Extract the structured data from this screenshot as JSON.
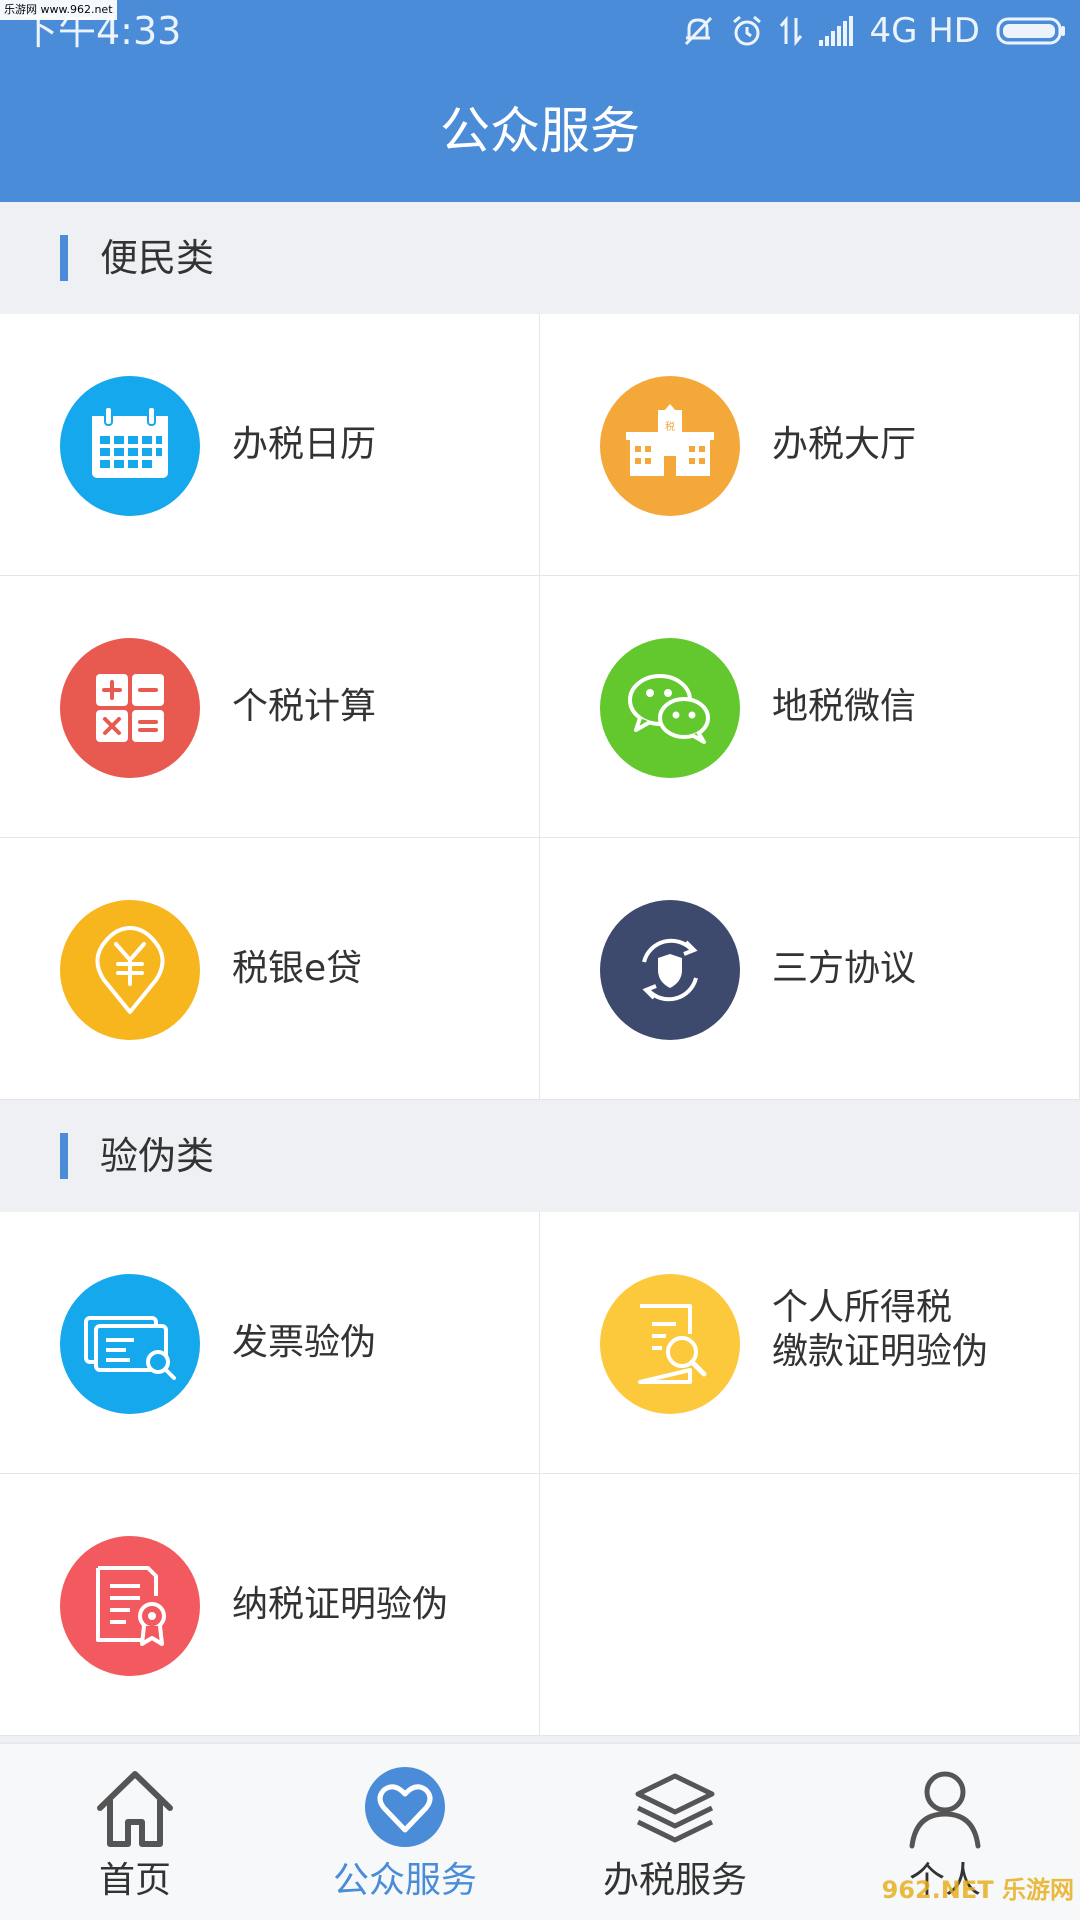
{
  "status_bar": {
    "watermark": "乐游网 www.962.net",
    "time": "下午4:33",
    "network": "4G HD"
  },
  "header": {
    "title": "公众服务"
  },
  "sections": [
    {
      "title": "便民类",
      "items": [
        {
          "label": "办税日历",
          "icon": "calendar-icon",
          "color": "#16a8ec"
        },
        {
          "label": "办税大厅",
          "icon": "tax-hall-building-icon",
          "color": "#f4a83a"
        },
        {
          "label": "个税计算",
          "icon": "calculator-icon",
          "color": "#e85a4f"
        },
        {
          "label": "地税微信",
          "icon": "wechat-icon",
          "color": "#62c82d"
        },
        {
          "label": "税银e贷",
          "icon": "yen-loan-icon",
          "color": "#f7b51e"
        },
        {
          "label": "三方协议",
          "icon": "shield-sync-icon",
          "color": "#3d4a6e"
        }
      ]
    },
    {
      "title": "验伪类",
      "items": [
        {
          "label": "发票验伪",
          "icon": "invoice-search-icon",
          "color": "#16a8ec"
        },
        {
          "label_line1": "个人所得税",
          "label_line2": "缴款证明验伪",
          "icon": "document-search-icon",
          "color": "#fcc93c"
        },
        {
          "label": "纳税证明验伪",
          "icon": "certificate-icon",
          "color": "#f25a5f"
        }
      ]
    }
  ],
  "tabbar": {
    "tabs": [
      {
        "label": "首页",
        "icon": "home-icon",
        "active": false
      },
      {
        "label": "公众服务",
        "icon": "heart-icon",
        "active": true
      },
      {
        "label": "办税服务",
        "icon": "layers-icon",
        "active": false
      },
      {
        "label": "个人",
        "icon": "person-icon",
        "active": false
      }
    ]
  },
  "watermark_bottom": "962.NET 乐游网",
  "colors": {
    "primary": "#4a8cd8",
    "background": "#eef0f4",
    "text": "#333333"
  }
}
